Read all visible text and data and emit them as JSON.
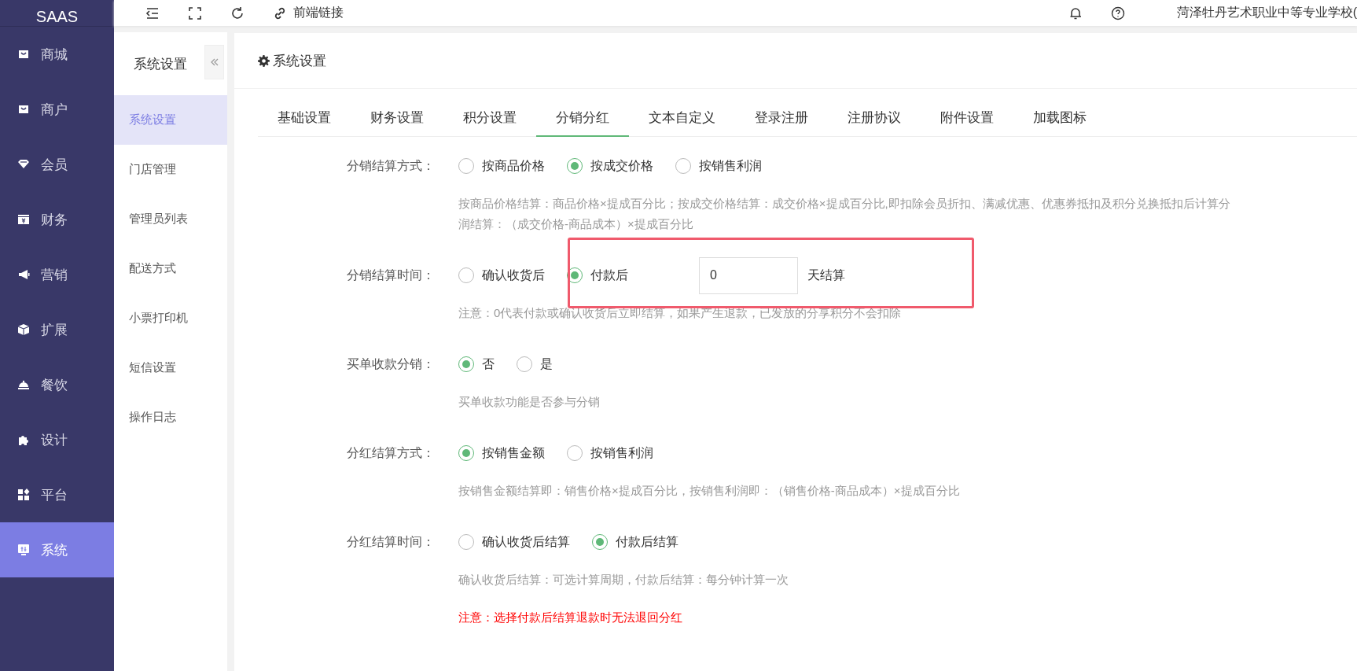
{
  "brand": "SAAS",
  "topbar": {
    "link": "前端链接",
    "user": "菏泽牡丹艺术职业中等专业学校("
  },
  "nav": [
    {
      "label": "商城",
      "selected": false
    },
    {
      "label": "商户",
      "selected": false
    },
    {
      "label": "会员",
      "selected": false
    },
    {
      "label": "财务",
      "selected": false
    },
    {
      "label": "营销",
      "selected": false
    },
    {
      "label": "扩展",
      "selected": false
    },
    {
      "label": "餐饮",
      "selected": false
    },
    {
      "label": "设计",
      "selected": false
    },
    {
      "label": "平台",
      "selected": false
    },
    {
      "label": "系统",
      "selected": true
    }
  ],
  "submenu": {
    "title": "系统设置",
    "items": [
      {
        "label": "系统设置",
        "selected": true
      },
      {
        "label": "门店管理",
        "selected": false
      },
      {
        "label": "管理员列表",
        "selected": false
      },
      {
        "label": "配送方式",
        "selected": false
      },
      {
        "label": "小票打印机",
        "selected": false
      },
      {
        "label": "短信设置",
        "selected": false
      },
      {
        "label": "操作日志",
        "selected": false
      }
    ]
  },
  "panel": {
    "title": "系统设置"
  },
  "tabs": [
    {
      "label": "基础设置",
      "selected": false
    },
    {
      "label": "财务设置",
      "selected": false
    },
    {
      "label": "积分设置",
      "selected": false
    },
    {
      "label": "分销分红",
      "selected": true
    },
    {
      "label": "文本自定义",
      "selected": false
    },
    {
      "label": "登录注册",
      "selected": false
    },
    {
      "label": "注册协议",
      "selected": false
    },
    {
      "label": "附件设置",
      "selected": false
    },
    {
      "label": "加载图标",
      "selected": false
    }
  ],
  "form": [
    {
      "label": "分销结算方式：",
      "options": [
        {
          "label": "按商品价格",
          "selected": false
        },
        {
          "label": "按成交价格",
          "selected": true
        },
        {
          "label": "按销售利润",
          "selected": false
        }
      ],
      "notes": [
        {
          "kind": "hint",
          "text": "按商品价格结算：商品价格×提成百分比；按成交价格结算：成交价格×提成百分比,即扣除会员折扣、满减优惠、优惠券抵扣及积分兑换抵扣后计算分"
        },
        {
          "kind": "hint",
          "text": "润结算：（成交价格-商品成本）×提成百分比"
        }
      ]
    },
    {
      "label": "分销结算时间：",
      "options": [
        {
          "label": "确认收货后",
          "selected": false
        },
        {
          "label": "付款后",
          "selected": true
        }
      ],
      "input": {
        "value": "0",
        "suffix": "天结算"
      },
      "notes": [
        {
          "kind": "hint",
          "text": "注意：0代表付款或确认收货后立即结算，如果产生退款，已发放的分享积分不会扣除"
        }
      ]
    },
    {
      "label": "买单收款分销：",
      "options": [
        {
          "label": "否",
          "selected": true
        },
        {
          "label": "是",
          "selected": false
        }
      ],
      "notes": [
        {
          "kind": "hint",
          "text": "买单收款功能是否参与分销"
        }
      ]
    },
    {
      "label": "分红结算方式：",
      "options": [
        {
          "label": "按销售金额",
          "selected": true
        },
        {
          "label": "按销售利润",
          "selected": false
        }
      ],
      "notes": [
        {
          "kind": "hint",
          "text": "按销售金额结算即：销售价格×提成百分比，按销售利润即：（销售价格-商品成本）×提成百分比"
        }
      ]
    },
    {
      "label": "分红结算时间：",
      "options": [
        {
          "label": "确认收货后结算",
          "selected": false
        },
        {
          "label": "付款后结算",
          "selected": true
        }
      ],
      "notes": [
        {
          "kind": "hint",
          "text": "确认收货后结算：可选计算周期，付款后结算：每分钟计算一次"
        },
        {
          "kind": "warning",
          "text": "注意：选择付款后结算退款时无法退回分红"
        }
      ]
    }
  ]
}
